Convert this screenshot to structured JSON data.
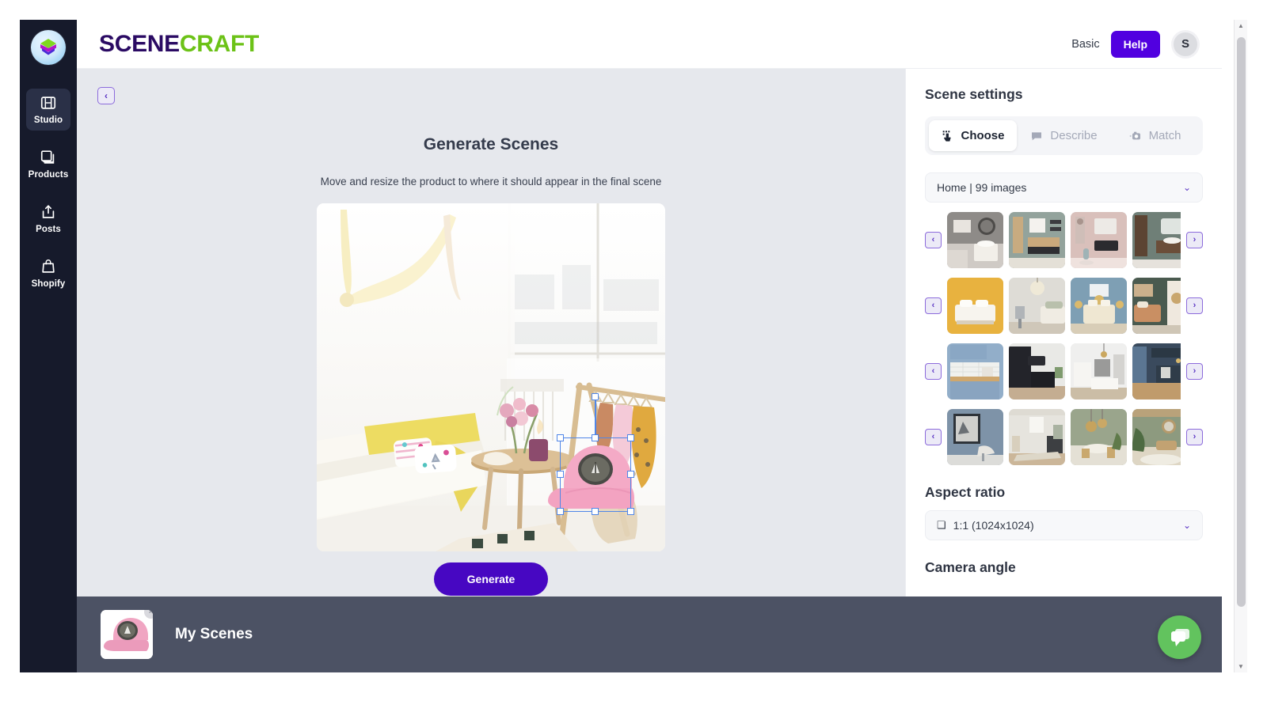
{
  "colors": {
    "rail_bg": "#161a2b",
    "brand_dark": "#2a0a63",
    "brand_green": "#6cc217",
    "accent_purple": "#5100e0",
    "generate_purple": "#4707c2",
    "canvas_bg": "#e6e8ed",
    "bottombar_bg": "#4c5264",
    "chat_green": "#62c35e",
    "selection_blue": "#4f86e8"
  },
  "sidebar": {
    "logo_name": "scenecraft-logo",
    "items": [
      {
        "label": "Studio",
        "icon": "film-strip-icon",
        "active": true
      },
      {
        "label": "Products",
        "icon": "stacked-squares-icon",
        "active": false
      },
      {
        "label": "Posts",
        "icon": "upload-box-icon",
        "active": false
      },
      {
        "label": "Shopify",
        "icon": "shopping-bag-icon",
        "active": false
      }
    ]
  },
  "header": {
    "brand_first": "SCENE",
    "brand_second": "CRAFT",
    "plan_label": "Basic",
    "help_label": "Help",
    "avatar_initial": "S"
  },
  "canvas": {
    "collapse_icon": "‹",
    "title": "Generate Scenes",
    "subtitle": "Move and resize the product to where it should appear in the final scene",
    "generate_label": "Generate",
    "scene_description": "Bright bedroom with sheer curtains, yellow bedding, pillows, side table with flowers and a wooden clothes rack",
    "placed_product": "pink baseball cap"
  },
  "panel": {
    "title": "Scene settings",
    "tabs": [
      {
        "label": "Choose",
        "icon": "hand-pointer-icon",
        "active": true
      },
      {
        "label": "Describe",
        "icon": "speech-bubble-icon",
        "active": false
      },
      {
        "label": "Match",
        "icon": "camera-icon",
        "active": false
      }
    ],
    "category_select": {
      "value": "Home | 99 images",
      "caret": "⌄"
    },
    "thumb_rows": [
      {
        "name": "bathroom-row",
        "prev_icon": "‹",
        "next_icon": "›",
        "thumbs": [
          {
            "alt": "grey tiled bathroom with round mirror and vessel sink",
            "c1": "#8e8b88",
            "c2": "#cfcac5",
            "c3": "#e8e4df"
          },
          {
            "alt": "wood and white bathroom vanity with tall cabinet",
            "c1": "#93a39c",
            "c2": "#d8d2c6",
            "c3": "#f1eee8"
          },
          {
            "alt": "pink wall bathroom with black floating vanity",
            "c1": "#d9c0bb",
            "c2": "#efe2de",
            "c3": "#2b2b2f"
          },
          {
            "alt": "dark green bathroom with walnut cabinets",
            "c1": "#6f7f77",
            "c2": "#5c4433",
            "c3": "#e6e2dc"
          }
        ]
      },
      {
        "name": "bedroom-row",
        "prev_icon": "‹",
        "next_icon": "›",
        "thumbs": [
          {
            "alt": "white bed on yellow background",
            "c1": "#e8b23f",
            "c2": "#f6f2ea",
            "c3": "#d6d0c4"
          },
          {
            "alt": "light grey bedroom with pendant lamp",
            "c1": "#dedcd6",
            "c2": "#f2f1ec",
            "c3": "#b9c0ac"
          },
          {
            "alt": "blue bedroom with gold pendant lights",
            "c1": "#7e9fb4",
            "c2": "#efe7d2",
            "c3": "#d9b86a"
          },
          {
            "alt": "dark green bedroom with art and rattan mirror",
            "c1": "#4a5a4f",
            "c2": "#c98f63",
            "c3": "#efe8de"
          }
        ]
      },
      {
        "name": "kitchen-row",
        "prev_icon": "‹",
        "next_icon": "›",
        "thumbs": [
          {
            "alt": "blue kitchen cabinets with white tile backsplash",
            "c1": "#92aec9",
            "c2": "#f0f1ee",
            "c3": "#cfa76d"
          },
          {
            "alt": "black modern kitchen with island",
            "c1": "#23242a",
            "c2": "#e9e9e6",
            "c3": "#c4ad91"
          },
          {
            "alt": "white kitchen with pendant lights and island",
            "c1": "#efefee",
            "c2": "#cbbda6",
            "c3": "#9a9a99"
          },
          {
            "alt": "blue dark kitchen with wood floor",
            "c1": "#3a4a5d",
            "c2": "#c09b6b",
            "c3": "#d5d6d2"
          }
        ]
      },
      {
        "name": "living-room-row",
        "prev_icon": "‹",
        "next_icon": "›",
        "thumbs": [
          {
            "alt": "blue grey living room with framed art and lounge chair",
            "c1": "#7e93a8",
            "c2": "#dcdcd9",
            "c3": "#2e3339"
          },
          {
            "alt": "neutral hallway with bench and plant",
            "c1": "#e6e4de",
            "c2": "#cbb699",
            "c3": "#a9b2a1"
          },
          {
            "alt": "sage green dining area with gold pendants",
            "c1": "#9aa58c",
            "c2": "#e4e0d5",
            "c3": "#c6a35e"
          },
          {
            "alt": "green living room with plants and round mirror",
            "c1": "#8d9a7f",
            "c2": "#ded6c4",
            "c3": "#b59a6c"
          }
        ]
      }
    ],
    "aspect_ratio": {
      "heading": "Aspect ratio",
      "value": "1:1 (1024x1024)",
      "icon": "square-icon",
      "caret": "⌄"
    },
    "camera_angle": {
      "heading": "Camera angle"
    }
  },
  "bottombar": {
    "product_alt": "pink baseball cap product thumbnail",
    "remove_icon": "×",
    "label": "My Scenes",
    "chat_icon": "chat-bubbles-icon"
  },
  "scrollbar": {
    "up": "▲",
    "down": "▼"
  }
}
